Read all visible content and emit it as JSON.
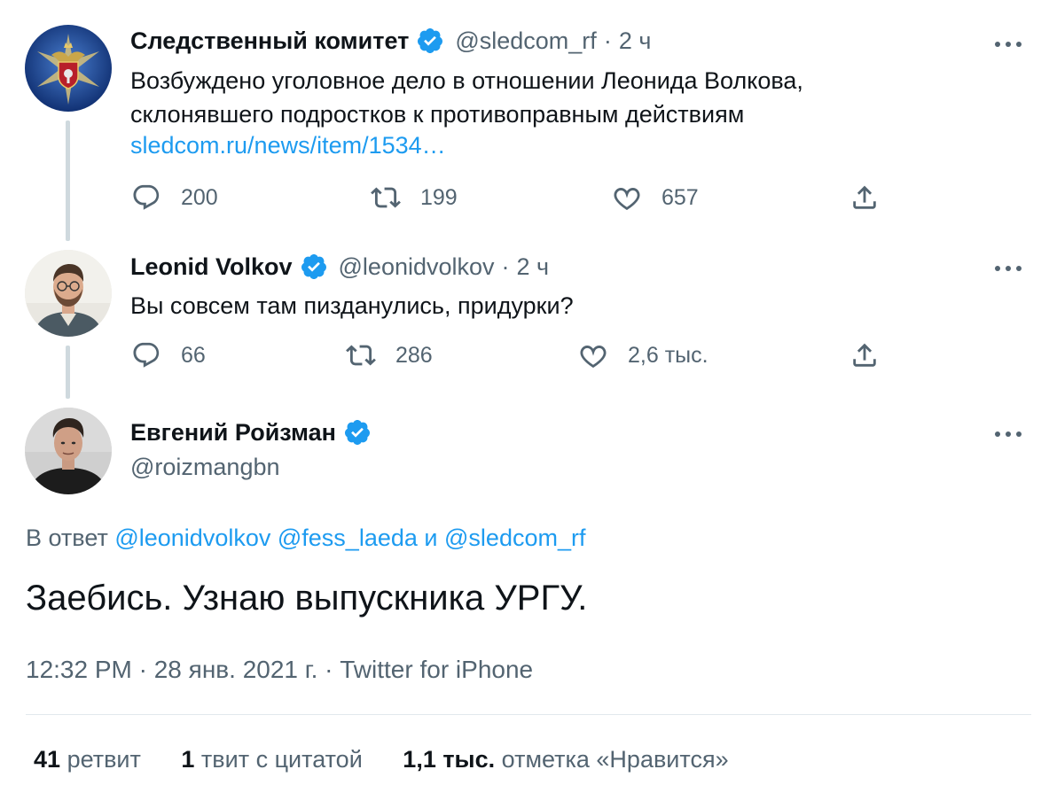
{
  "thread": [
    {
      "author_name": "Следственный комитет",
      "handle": "@sledcom_rf",
      "separator": "·",
      "time": "2 ч",
      "text_line1": "Возбуждено уголовное дело в отношении Леонида Волкова,",
      "text_line2": "склонявшего подростков к противоправным действиям",
      "link": "sledcom.ru/news/item/1534…",
      "replies": "200",
      "retweets": "199",
      "likes": "657"
    },
    {
      "author_name": "Leonid Volkov",
      "handle": "@leonidvolkov",
      "separator": "·",
      "time": "2 ч",
      "text_line1": "Вы совсем там пизданулись, придурки?",
      "replies": "66",
      "retweets": "286",
      "likes": "2,6 тыс."
    }
  ],
  "main_tweet": {
    "author_name": "Евгений Ройзман",
    "handle": "@roizmangbn",
    "reply_prefix": "В ответ",
    "reply_mention1": "@leonidvolkov",
    "reply_mention2": "@fess_laeda",
    "reply_conj": "и",
    "reply_mention3": "@sledcom_rf",
    "text": "Заебись. Узнаю выпускника УРГУ.",
    "meta": "12:32 PM · 28 янв. 2021 г. · Twitter for iPhone",
    "stats": {
      "retweets_num": "41",
      "retweets_label": "ретвит",
      "quotes_num": "1",
      "quotes_label": "твит с цитатой",
      "likes_num": "1,1 тыс.",
      "likes_label": "отметка «Нравится»"
    }
  },
  "icons": {
    "reply": "reply-icon",
    "retweet": "retweet-icon",
    "like": "heart-icon",
    "share": "share-icon",
    "verified": "verified-badge-icon",
    "more": "more-icon"
  },
  "colors": {
    "accent": "#1d9bf0",
    "secondary_text": "#536471",
    "primary_text": "#0f1419",
    "thread_line": "#cfd9de"
  }
}
